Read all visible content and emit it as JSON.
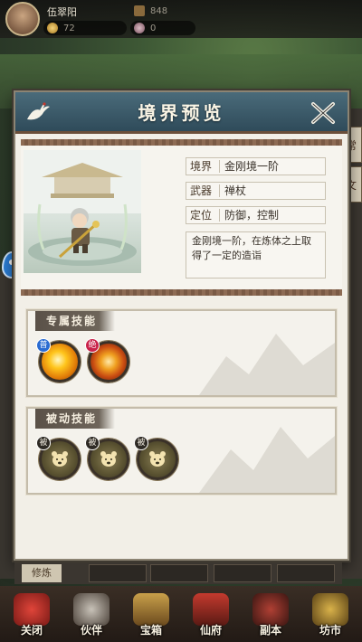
{
  "player": {
    "name": "伍翠阳",
    "coins": "72",
    "gold": "848",
    "jade": "0"
  },
  "modal": {
    "title": "境界预览",
    "info": {
      "realm_label": "境界",
      "realm_value": "金刚境一阶",
      "weapon_label": "武器",
      "weapon_value": "禅杖",
      "role_label": "定位",
      "role_value": "防御，控制",
      "description": "金刚境一阶，在炼体之上取得了一定的造诣"
    },
    "exclusive_skills": {
      "label": "专属技能",
      "items": [
        {
          "badge": "普",
          "badge_color": "#2a6bd1"
        },
        {
          "badge": "绝",
          "badge_color": "#c9224a"
        }
      ]
    },
    "passive_skills": {
      "label": "被动技能",
      "items": [
        {
          "badge": "被"
        },
        {
          "badge": "被"
        },
        {
          "badge": "被"
        }
      ]
    }
  },
  "side_tabs": [
    "常",
    "文"
  ],
  "bottom_strip": {
    "cultivate_label": "修炼"
  },
  "bottom_nav": [
    {
      "label": "关闭",
      "icon": "close-icon"
    },
    {
      "label": "伙伴",
      "icon": "partner-icon"
    },
    {
      "label": "宝箱",
      "icon": "chest-icon"
    },
    {
      "label": "仙府",
      "icon": "palace-icon"
    },
    {
      "label": "副本",
      "icon": "dungeon-icon"
    },
    {
      "label": "坊市",
      "icon": "market-icon"
    }
  ]
}
